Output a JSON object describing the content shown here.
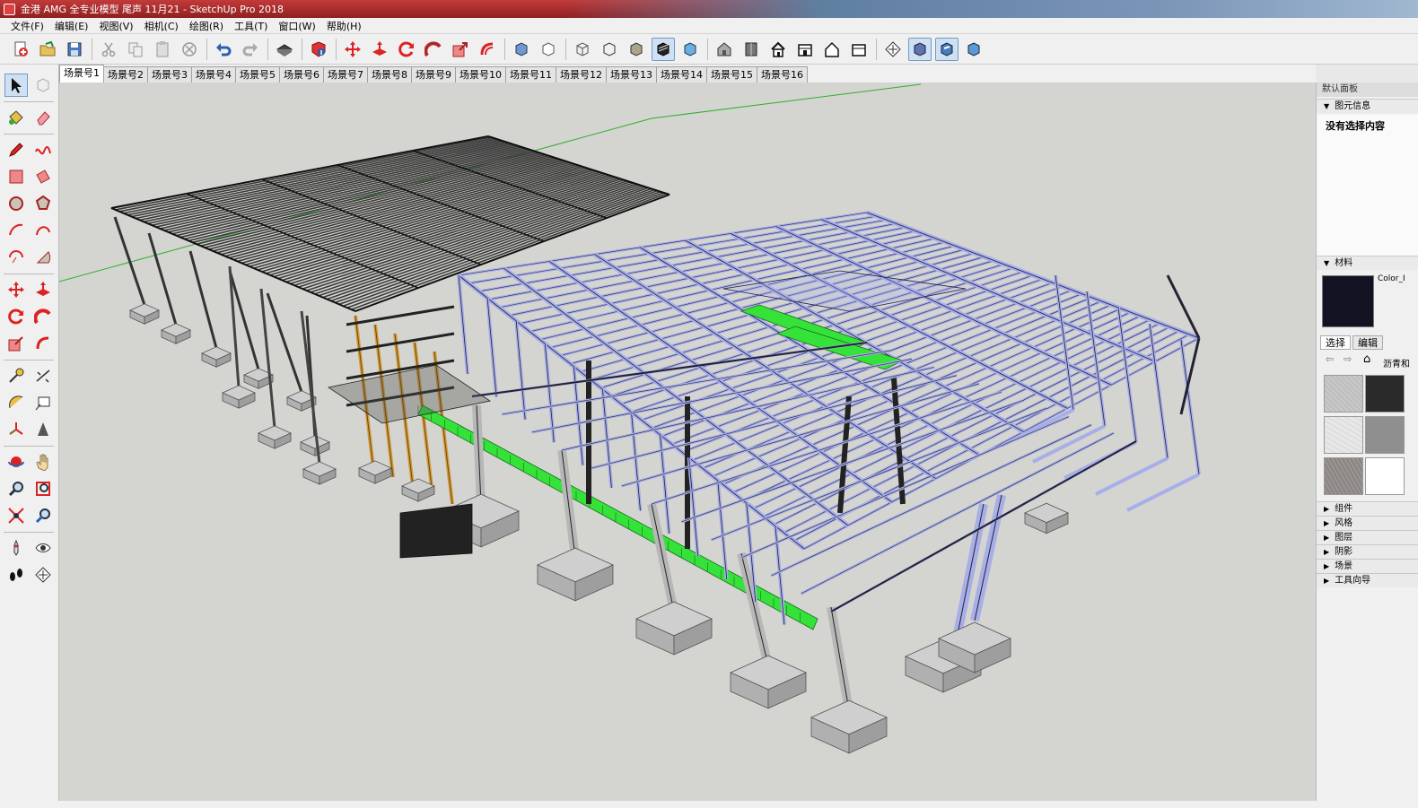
{
  "window": {
    "title": "金港 AMG 全专业模型 尾声 11月21 - SketchUp Pro 2018"
  },
  "menu": [
    "文件(F)",
    "编辑(E)",
    "视图(V)",
    "相机(C)",
    "绘图(R)",
    "工具(T)",
    "窗口(W)",
    "帮助(H)"
  ],
  "scenes": [
    "场景号1",
    "场景号2",
    "场景号3",
    "场景号4",
    "场景号5",
    "场景号6",
    "场景号7",
    "场景号8",
    "场景号9",
    "场景号10",
    "场景号11",
    "场景号12",
    "场景号13",
    "场景号14",
    "场景号15",
    "场景号16"
  ],
  "active_scene": "场景号1",
  "tray": {
    "title": "默认面板",
    "entity_info": {
      "label": "图元信息",
      "content": "没有选择内容"
    },
    "materials": {
      "label": "材料",
      "current": "Color_I",
      "tab_select": "选择",
      "tab_edit": "编辑",
      "collection": "沥青和"
    },
    "sections": [
      "组件",
      "风格",
      "图层",
      "阴影",
      "场景",
      "工具向导"
    ]
  },
  "colors": {
    "steel": "#a7aee8",
    "roof": "#3a3a3a",
    "green": "#35e23a",
    "orange": "#d49a3a",
    "concrete": "#c7c7c7",
    "viewport": "#d4d4d0"
  }
}
